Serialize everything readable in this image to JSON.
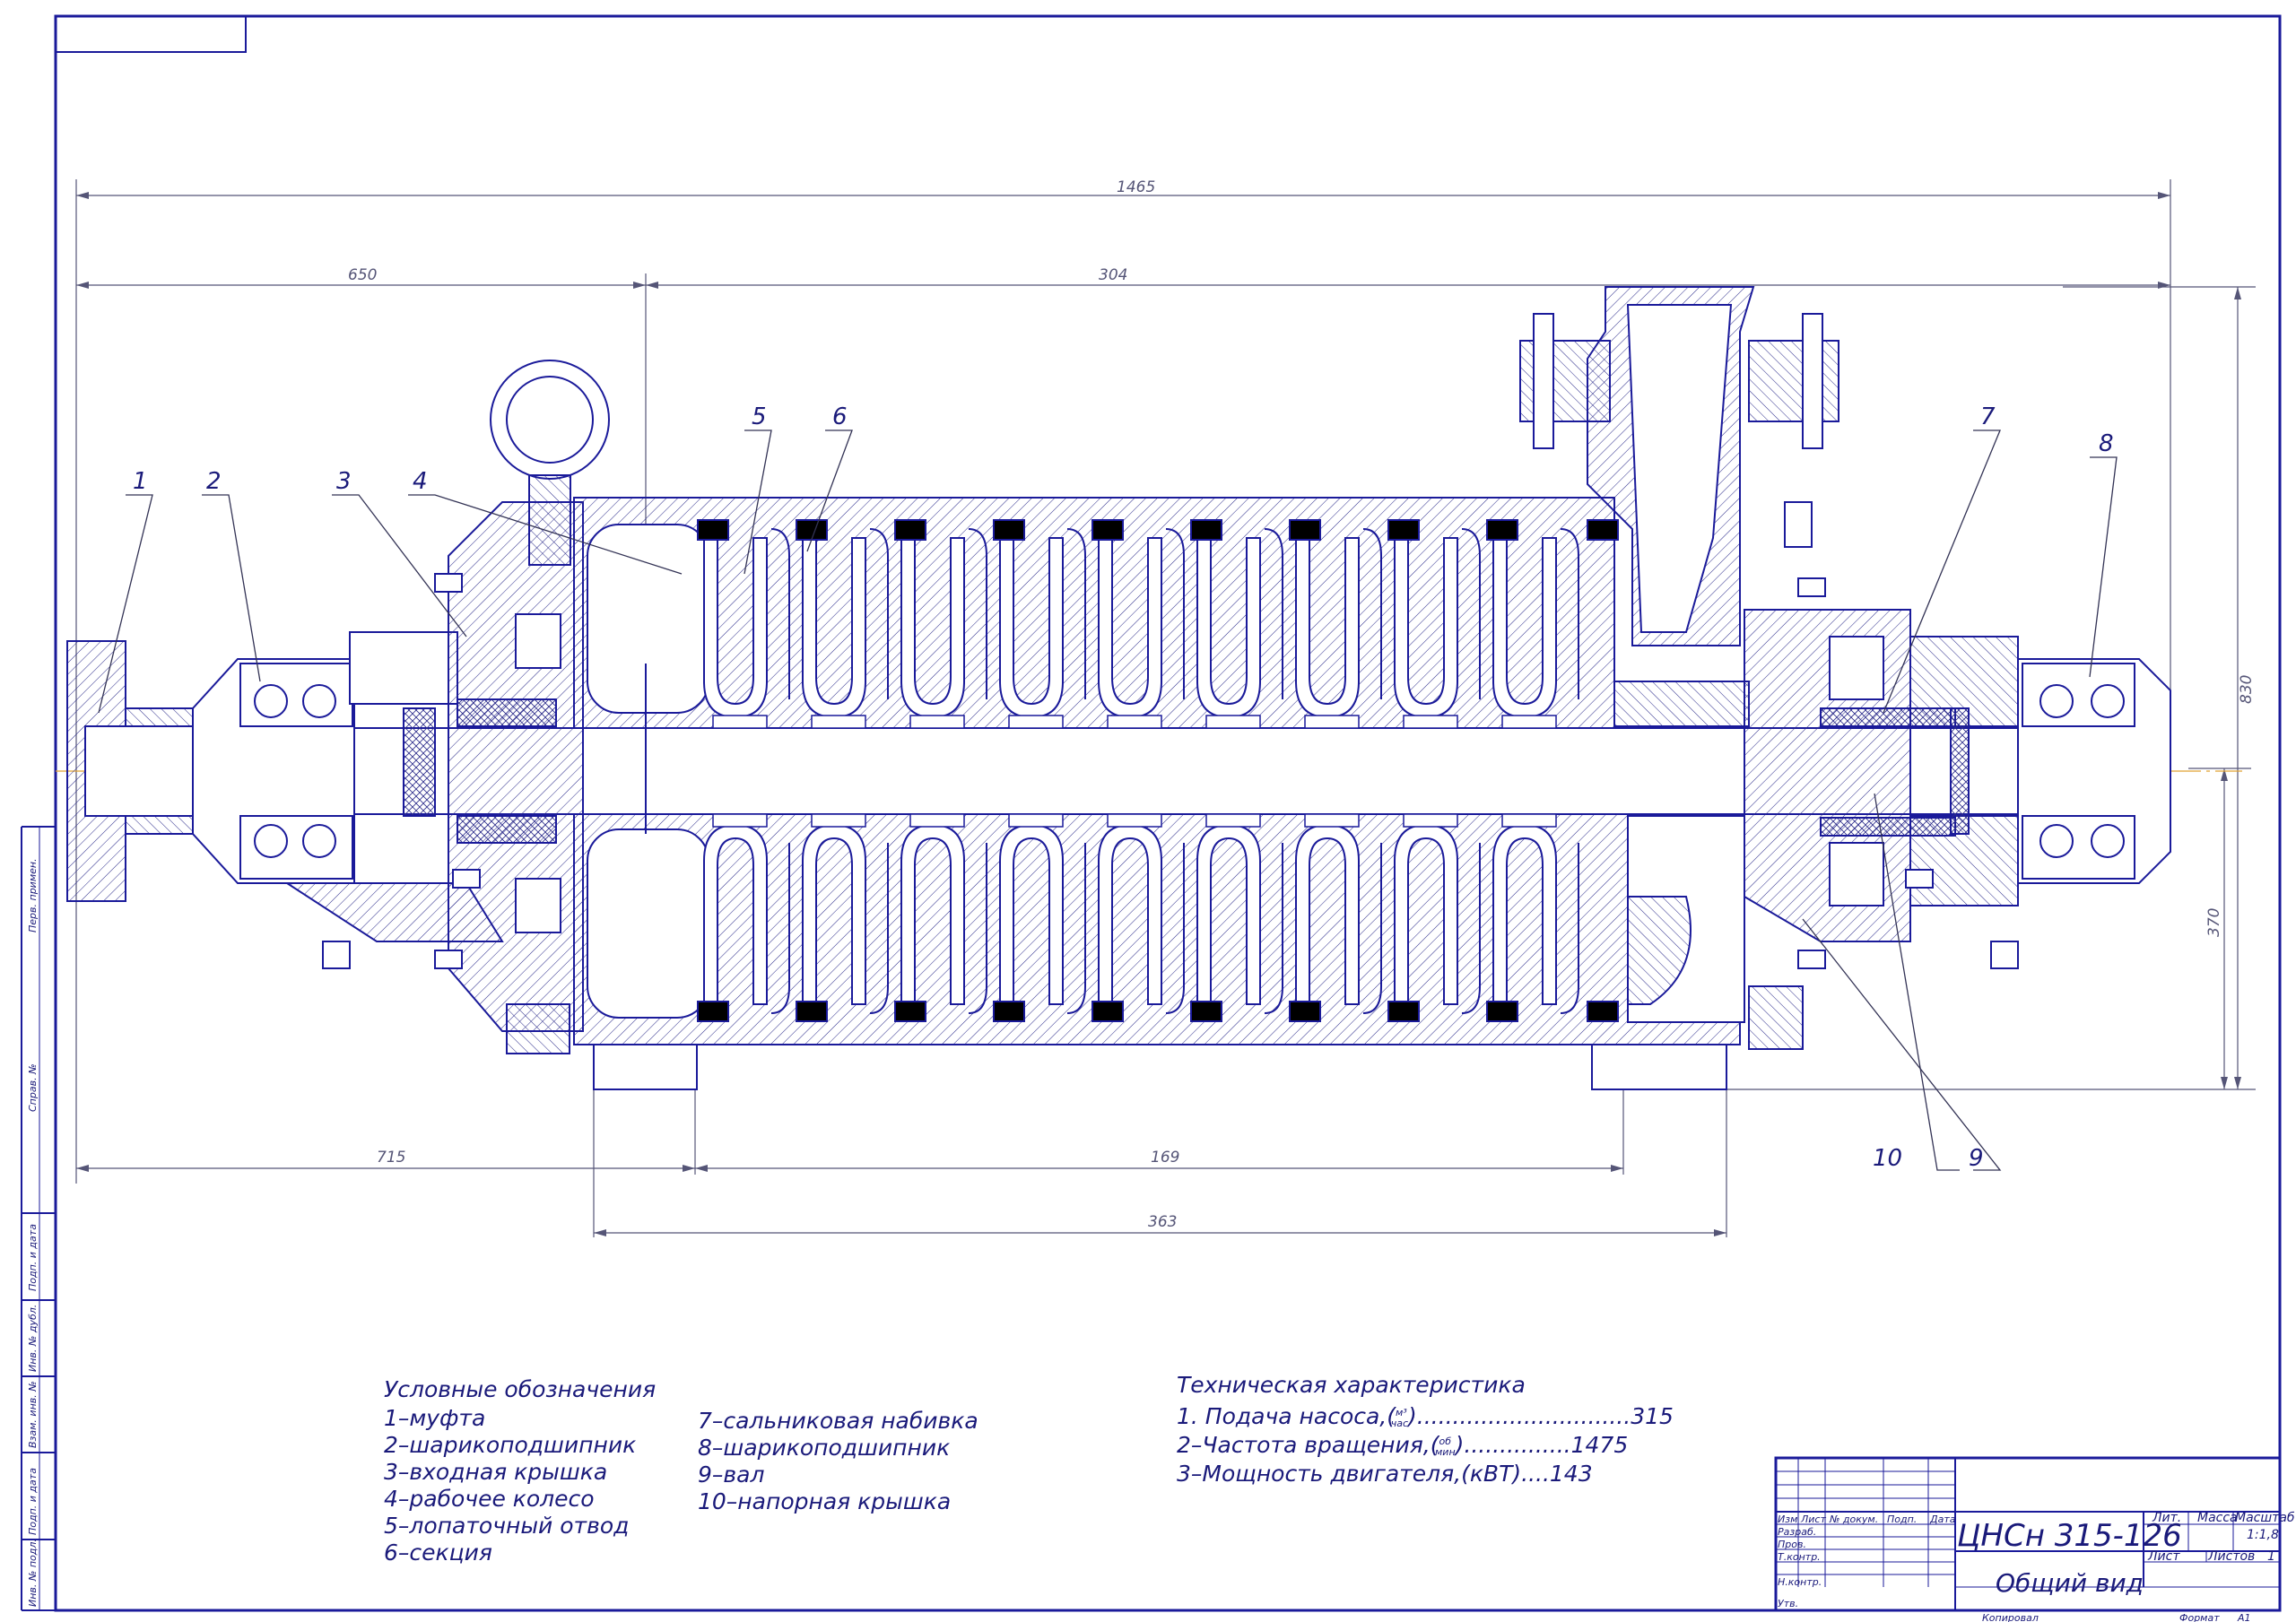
{
  "dimensions": {
    "overall": "1465",
    "left": "650",
    "span": "304",
    "height_total": "830",
    "height_lower": "370",
    "bottom_left": "715",
    "bottom_mid": "169",
    "bottom_total": "363"
  },
  "callouts": [
    "1",
    "2",
    "3",
    "4",
    "5",
    "6",
    "7",
    "8",
    "9",
    "10"
  ],
  "legend": {
    "title": "Условные обозначения",
    "col1": [
      "1–муфта",
      "2–шарикоподшипник",
      "3–входная крышка",
      "4–рабочее колесо",
      "5–лопаточный отвод",
      "6–секция"
    ],
    "col2": [
      "7–сальниковая набивка",
      "8–шарикоподшипник",
      "9–вал",
      "10–напорная крышка"
    ]
  },
  "tech": {
    "title": "Техническая характеристика",
    "line1_label": "1. Подача насоса,(",
    "line1_num": "м³",
    "line1_den": "час",
    "line1_tail": ")..............................315",
    "line2_label": "2–Частота вращения,(",
    "line2_num": "об",
    "line2_den": "мин",
    "line2_tail": ")...............1475",
    "line3": "3–Мощность двигателя,(кВТ)....143"
  },
  "titleblock": {
    "designation": "ЦНСн 315-126",
    "name": "Общий вид",
    "cols": [
      "Изм",
      "Лист",
      "№ докум.",
      "Подп.",
      "Дата"
    ],
    "rows": [
      "Разраб.",
      "Пров.",
      "Т.контр.",
      "Н.контр.",
      "Утв."
    ],
    "lit": "Лит.",
    "mass": "Масса",
    "scale": "Масштаб",
    "scale_value": "1:1,8",
    "sheet": "Лист",
    "sheets": "Листов",
    "sheets_value": "1",
    "copied": "Копировал",
    "format": "Формат",
    "format_value": "А1"
  },
  "side_stamp": [
    "Перв. примен.",
    "Справ. №",
    "Подп. и дата",
    "Инв. № дубл.",
    "Взам. инв. №",
    "Подп. и дата",
    "Инв. № подл."
  ]
}
